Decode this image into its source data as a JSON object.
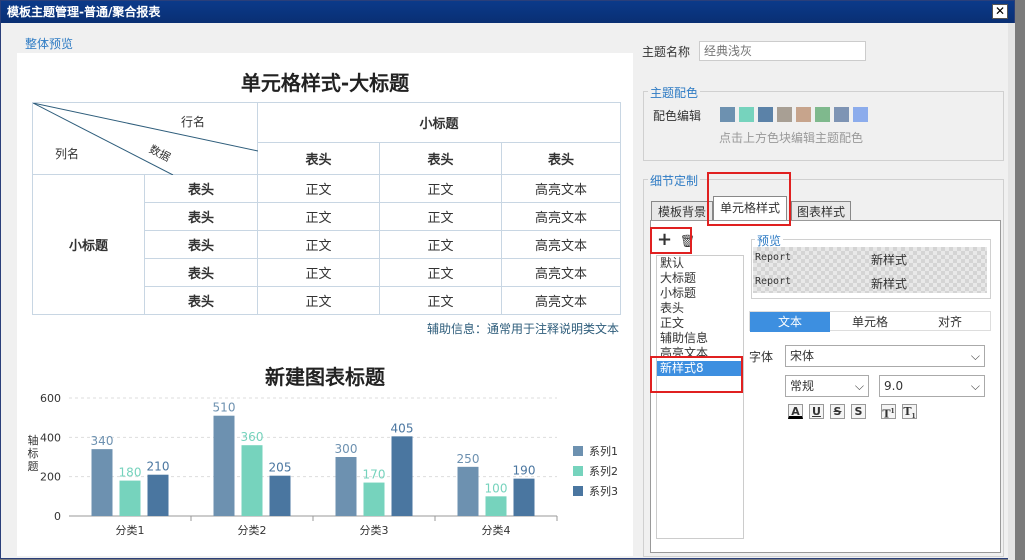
{
  "window": {
    "title": "模板主题管理-普通/聚合报表",
    "close": "✕"
  },
  "preview": {
    "group_label": "整体预览",
    "table_title": "单元格样式-大标题",
    "diag_row": "行名",
    "diag_data": "数据",
    "diag_col": "列名",
    "subtitle": "小标题",
    "header": "表头",
    "body": "正文",
    "highlight": "高亮文本",
    "aux": "辅助信息：通常用于注释说明类文本",
    "chart_title": "新建图表标题"
  },
  "chart_data": {
    "type": "bar",
    "title": "新建图表标题",
    "ylabel": "轴标题",
    "xlabel": "",
    "categories": [
      "分类1",
      "分类2",
      "分类3",
      "分类4"
    ],
    "series": [
      {
        "name": "系列1",
        "color": "#6d91b0",
        "values": [
          340,
          510,
          300,
          250
        ]
      },
      {
        "name": "系列2",
        "color": "#76d3bd",
        "values": [
          180,
          360,
          170,
          100
        ]
      },
      {
        "name": "系列3",
        "color": "#4a76a0",
        "values": [
          210,
          205,
          405,
          190
        ]
      }
    ],
    "ylim": [
      0,
      600
    ],
    "yticks": [
      "0",
      "200",
      "400",
      "600"
    ],
    "legend": "right",
    "grid": true
  },
  "theme": {
    "name_label": "主题名称",
    "name_placeholder": "经典浅灰",
    "color_group": "主题配色",
    "color_edit_label": "配色编辑",
    "color_hint": "点击上方色块编辑主题配色",
    "swatches": [
      "#6d91b0",
      "#76d3bd",
      "#5b82a8",
      "#a89f94",
      "#c7a48c",
      "#7fb98d",
      "#7e94b4",
      "#8cacec"
    ]
  },
  "detail": {
    "group": "细节定制",
    "tabs": [
      "模板背景",
      "单元格样式",
      "图表样式"
    ],
    "add": "+",
    "delete": "🗑",
    "styles": [
      "默认",
      "大标题",
      "小标题",
      "表头",
      "正文",
      "辅助信息",
      "高亮文本",
      "新样式8"
    ],
    "preview_label": "预览",
    "preview_rows": [
      {
        "left": "Report",
        "right": "新样式"
      },
      {
        "left": "Report",
        "right": "新样式"
      }
    ],
    "subtabs": [
      "文本",
      "单元格",
      "对齐"
    ],
    "font_label": "字体",
    "font_value": "宋体",
    "style_value": "常规",
    "size_value": "9.0",
    "fmt": [
      "A",
      "U",
      "S",
      "S",
      "T",
      "T"
    ]
  }
}
